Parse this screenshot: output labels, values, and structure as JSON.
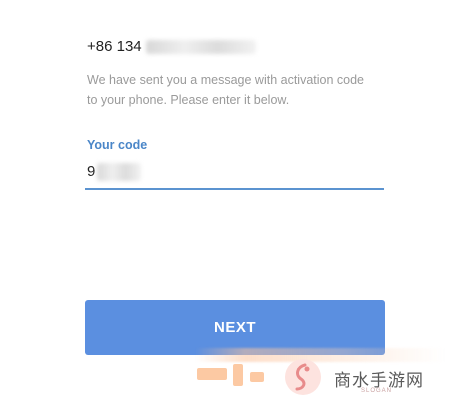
{
  "phone": {
    "number_prefix": "+86 134"
  },
  "message": {
    "text": "We have sent you a message with activation code to your phone. Please enter it below."
  },
  "code_field": {
    "label": "Your code",
    "value_prefix": "9"
  },
  "next_button": {
    "label": "NEXT"
  },
  "watermark": {
    "site_name": "商水手游网",
    "slogan": "SLOGAN",
    "color": "#fbbf93"
  },
  "colors": {
    "accent": "#4a86c8",
    "button": "#5b8fe0",
    "muted_text": "#9a9a9a"
  }
}
